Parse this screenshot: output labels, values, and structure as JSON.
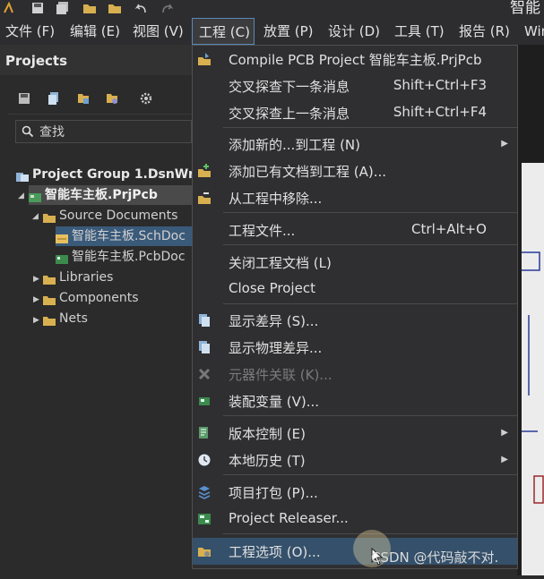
{
  "window": {
    "title_fragment": "智能"
  },
  "menubar": {
    "items": [
      {
        "label": "文件 (F)",
        "active": false
      },
      {
        "label": "编辑 (E)",
        "active": false
      },
      {
        "label": "视图 (V)",
        "active": false
      },
      {
        "label": "工程 (C)",
        "active": true
      },
      {
        "label": "放置 (P)",
        "active": false
      },
      {
        "label": "设计 (D)",
        "active": false
      },
      {
        "label": "工具 (T)",
        "active": false
      },
      {
        "label": "报告 (R)",
        "active": false
      },
      {
        "label": "Win",
        "active": false
      }
    ]
  },
  "panel": {
    "title": "Projects",
    "search_placeholder": "查找",
    "tree": [
      {
        "label": "Project Group 1.DsnWrk",
        "icon": "workspace-icon"
      },
      {
        "label": "智能车主板.PrjPcb",
        "icon": "pcb-project-icon"
      },
      {
        "label": "Source Documents",
        "icon": "folder-icon"
      },
      {
        "label": "智能车主板.SchDoc",
        "icon": "schematic-doc-icon"
      },
      {
        "label": "智能车主板.PcbDoc",
        "icon": "pcb-doc-icon"
      },
      {
        "label": "Libraries",
        "icon": "folder-icon"
      },
      {
        "label": "Components",
        "icon": "folder-icon"
      },
      {
        "label": "Nets",
        "icon": "folder-icon"
      }
    ]
  },
  "dropdown": {
    "items": [
      {
        "label": "Compile PCB Project 智能车主板.PrjPcb",
        "shortcut": "",
        "icon": "compile-icon",
        "submenu": false,
        "disabled": false
      },
      {
        "label": "交叉探查下一条消息",
        "shortcut": "Shift+Ctrl+F3",
        "icon": "",
        "submenu": false,
        "disabled": false
      },
      {
        "label": "交叉探查上一条消息",
        "shortcut": "Shift+Ctrl+F4",
        "icon": "",
        "submenu": false,
        "disabled": false
      },
      {
        "label": "添加新的...到工程 (N)",
        "shortcut": "",
        "icon": "",
        "submenu": true,
        "disabled": false
      },
      {
        "label": "添加已有文档到工程 (A)...",
        "shortcut": "",
        "icon": "add-document-icon",
        "submenu": false,
        "disabled": false
      },
      {
        "label": "从工程中移除...",
        "shortcut": "",
        "icon": "remove-document-icon",
        "submenu": false,
        "disabled": false
      },
      {
        "label": "工程文件...",
        "shortcut": "Ctrl+Alt+O",
        "icon": "",
        "submenu": false,
        "disabled": false
      },
      {
        "label": "关闭工程文档 (L)",
        "shortcut": "",
        "icon": "",
        "submenu": false,
        "disabled": false
      },
      {
        "label": "Close Project",
        "shortcut": "",
        "icon": "",
        "submenu": false,
        "disabled": false
      },
      {
        "label": "显示差异 (S)...",
        "shortcut": "",
        "icon": "show-differences-icon",
        "submenu": false,
        "disabled": false
      },
      {
        "label": "显示物理差异...",
        "shortcut": "",
        "icon": "physical-differences-icon",
        "submenu": false,
        "disabled": false
      },
      {
        "label": "元器件关联 (K)...",
        "shortcut": "",
        "icon": "component-links-icon",
        "submenu": false,
        "disabled": true
      },
      {
        "label": "装配变量 (V)...",
        "shortcut": "",
        "icon": "variants-icon",
        "submenu": false,
        "disabled": false
      },
      {
        "label": "版本控制 (E)",
        "shortcut": "",
        "icon": "version-control-icon",
        "submenu": true,
        "disabled": false
      },
      {
        "label": "本地历史 (T)",
        "shortcut": "",
        "icon": "local-history-icon",
        "submenu": true,
        "disabled": false
      },
      {
        "label": "项目打包 (P)...",
        "shortcut": "",
        "icon": "project-packager-icon",
        "submenu": false,
        "disabled": false
      },
      {
        "label": "Project Releaser...",
        "shortcut": "",
        "icon": "project-releaser-icon",
        "submenu": false,
        "disabled": false
      },
      {
        "label": "工程选项 (O)...",
        "shortcut": "",
        "icon": "project-options-icon",
        "submenu": false,
        "disabled": false
      }
    ]
  },
  "watermark": "CSDN @代码敲不对.",
  "colors": {
    "accent": "#5b88b5",
    "highlight": "#34506b",
    "selection": "#3a5a7a"
  }
}
